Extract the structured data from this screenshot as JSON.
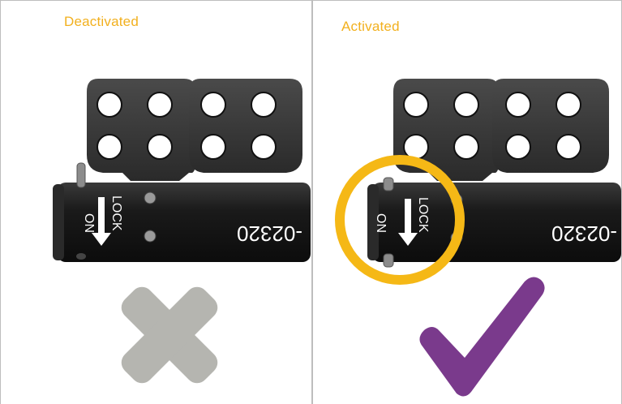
{
  "panels": {
    "deactivated": {
      "title": "Deactivated",
      "status_icon": "cross-icon",
      "status_color": "#b5b5b0"
    },
    "activated": {
      "title": "Activated",
      "status_icon": "checkmark-icon",
      "status_color": "#7a3a8c",
      "highlight_color": "#f5b816"
    }
  },
  "device": {
    "lock_label": "LOCK",
    "on_label": "ON",
    "serial_fragment": "-02320"
  },
  "colors": {
    "title_text": "#f2b01e",
    "device_body": "#1c1c1c",
    "divider": "#bdbdbd"
  }
}
